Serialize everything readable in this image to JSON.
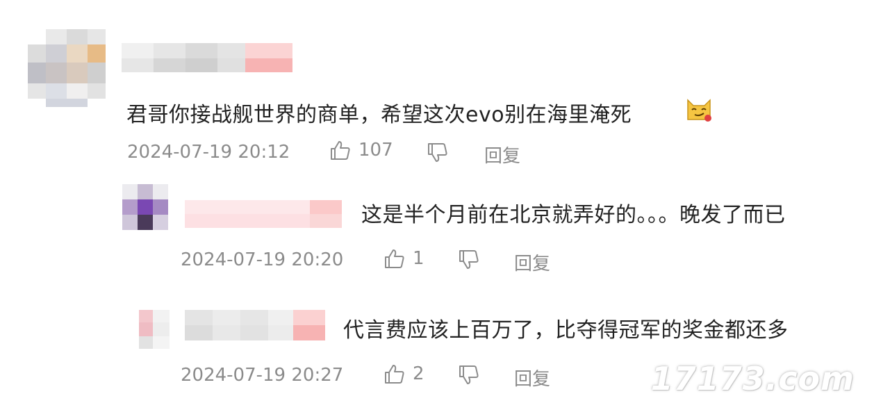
{
  "comments": [
    {
      "text": "君哥你接战舰世界的商单，希望这次evo别在海里淹死",
      "emoji": "smirking-cat-emoji",
      "time": "2024-07-19 20:12",
      "likes": "107",
      "reply": "回复"
    },
    {
      "text": "这是半个月前在北京就弄好的。。。晚发了而已",
      "time": "2024-07-19 20:20",
      "likes": "1",
      "reply": "回复"
    },
    {
      "text": "代言费应该上百万了，比夺得冠军的奖金都还多",
      "time": "2024-07-19 20:27",
      "likes": "2",
      "reply": "回复"
    }
  ],
  "watermark": "17173.com",
  "icons": {
    "like": "thumbs-up-icon",
    "dislike": "thumbs-down-icon"
  },
  "colors": {
    "text": "#222222",
    "meta": "#8b8b8b",
    "blur_pink": "#f7b3b3"
  }
}
